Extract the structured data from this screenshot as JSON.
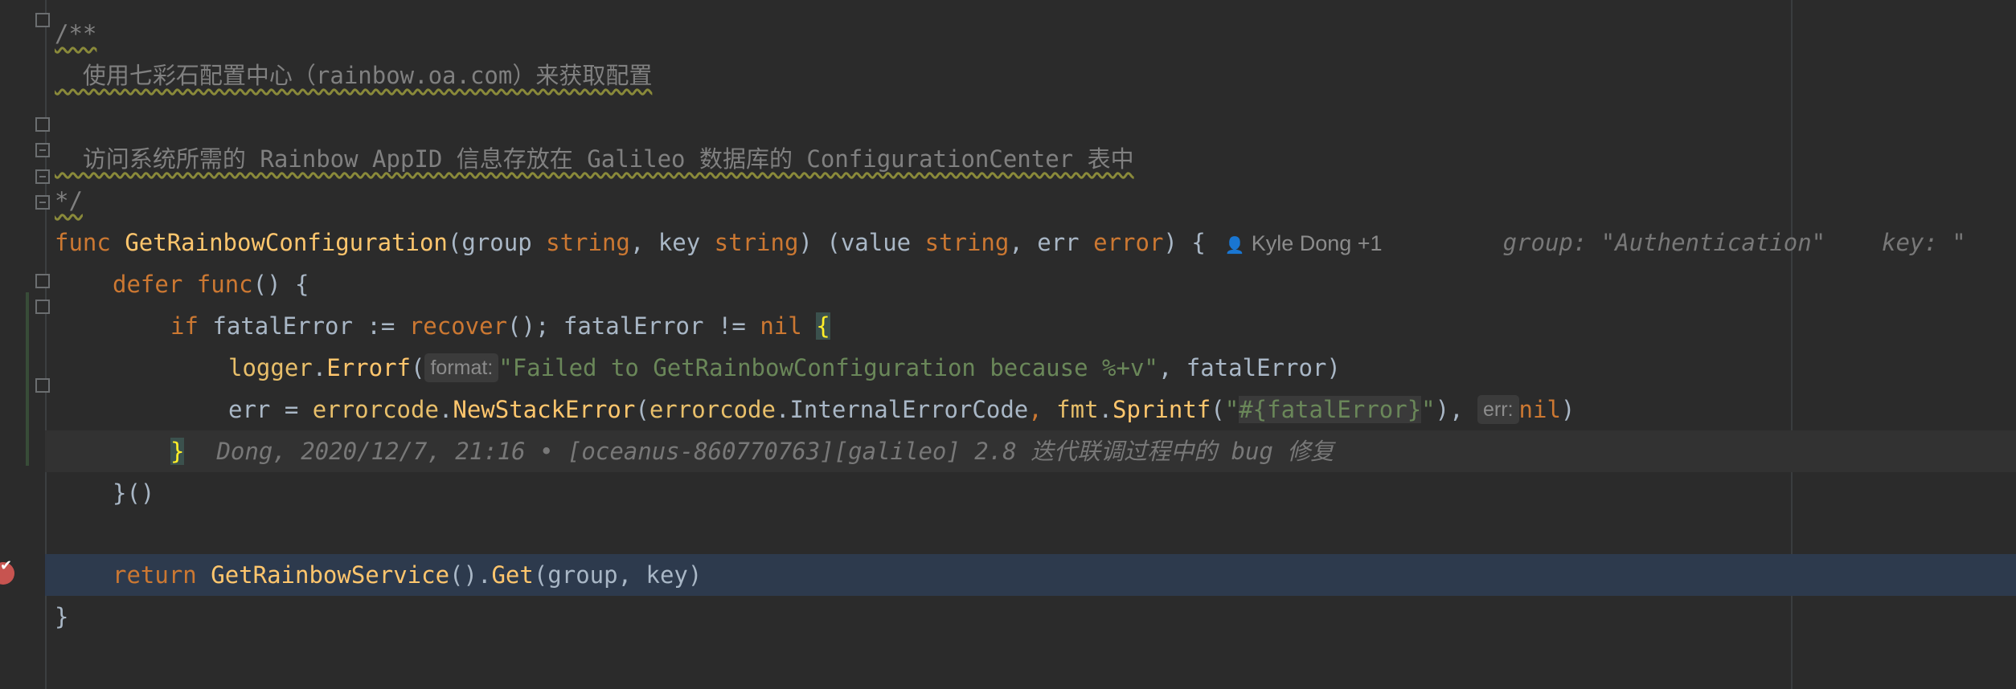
{
  "editor": {
    "lines": {
      "l1": {
        "text": "/**"
      },
      "l2": {
        "text": "  使用七彩石配置中心（rainbow.oa.com）来获取配置"
      },
      "l3": {
        "text": ""
      },
      "l4": {
        "text": "  访问系统所需的 Rainbow AppID 信息存放在 Galileo 数据库的 ConfigurationCenter 表中"
      },
      "l5": {
        "text": "*/"
      },
      "l6": {
        "kw_func": "func",
        "name": "GetRainbowConfiguration",
        "open": "(",
        "p1": "group ",
        "t1": "string",
        "comma1": ", ",
        "p2": "key ",
        "t2": "string",
        "mid": ") (",
        "p3": "value ",
        "t3": "string",
        "comma2": ", ",
        "p4": "err ",
        "t4": "error",
        "close": ") {",
        "author": "Kyle Dong +1",
        "inline_values": "group: \"Authentication\"    key: \""
      },
      "l7": {
        "kw_defer": "defer",
        "kw_func": "func",
        "rest": "() {"
      },
      "l8": {
        "kw_if": "if",
        "part1": " fatalError := ",
        "recover": "recover",
        "part2": "(); fatalError != ",
        "nil": "nil",
        "brace": "{"
      },
      "l9": {
        "pkg": "logger",
        "dot": ".",
        "fn": "Errorf",
        "open": "(",
        "hint": "format:",
        "str": "\"Failed to GetRainbowConfiguration because %+v\"",
        "rest": ", fatalError)"
      },
      "l10": {
        "lhs": "err = ",
        "pkg1": "errorcode",
        "fn1": "NewStackError",
        "open": "(",
        "pkg2": "errorcode",
        "rest1": "InternalErrorCode",
        "comma": ", ",
        "pkg3": "fmt",
        "fn2": "Sprintf",
        "q1": "\"",
        "tpl": "#{fatalError}",
        "q2": "\"",
        "rest2": "),",
        "hint": "err:",
        "nil": "nil",
        "end": ")"
      },
      "l11": {
        "brace": "}",
        "blame": "Dong, 2020/12/7, 21:16 • [oceanus-860770763][galileo] 2.8 迭代联调过程中的 bug 修复"
      },
      "l12": {
        "text": "}()"
      },
      "l13": {
        "text": ""
      },
      "l14": {
        "kw_return": "return",
        "fn": "GetRainbowService",
        "mid": "().",
        "get": "Get",
        "rest": "(group, key)"
      },
      "l15": {
        "text": "}"
      }
    }
  },
  "colors": {
    "background": "#2b2b2b",
    "keyword": "#cc7832",
    "function": "#ffc66d",
    "string": "#6a8759",
    "comment": "#808080",
    "default_text": "#a9b7c6",
    "exec_line": "#2d3a4d",
    "breakpoint": "#c75450"
  },
  "icons": {
    "breakpoint": "breakpoint-icon",
    "author": "person-icon",
    "fold": "fold-icon"
  }
}
